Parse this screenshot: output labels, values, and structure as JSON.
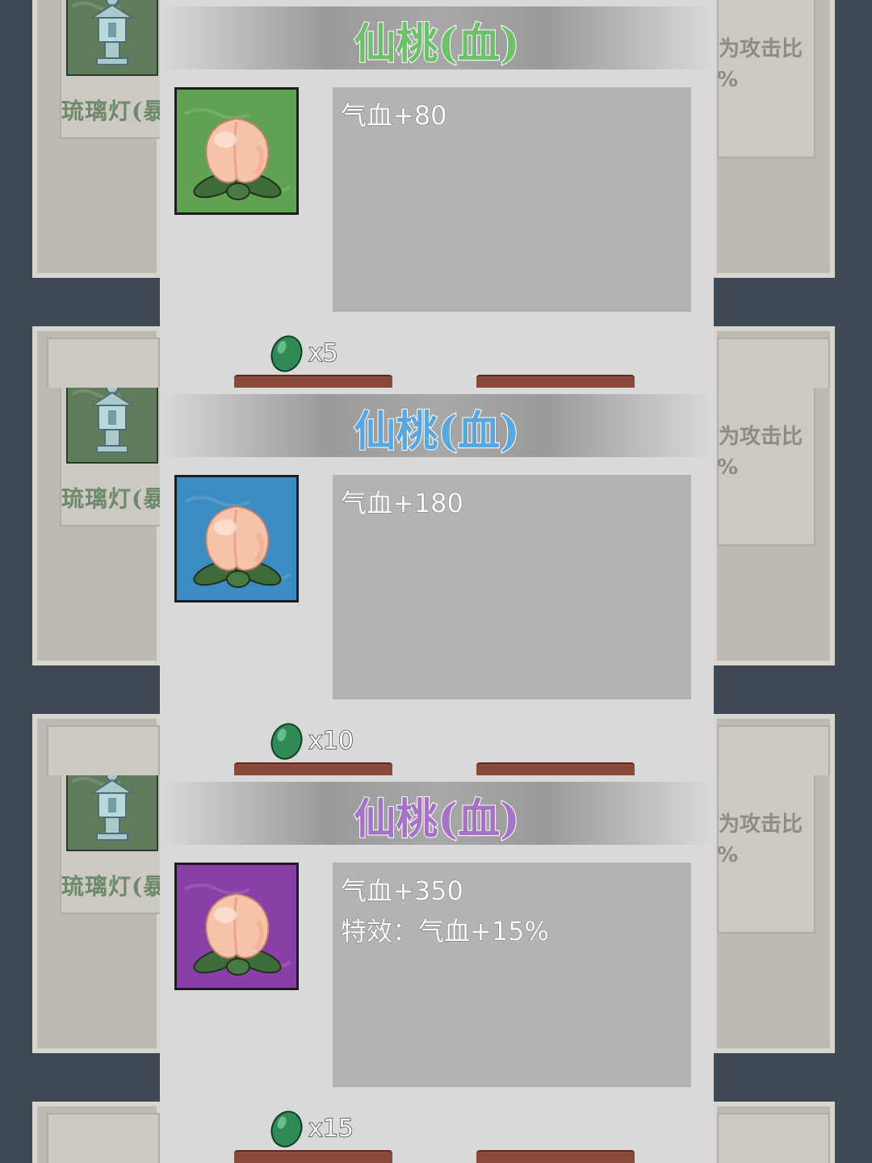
{
  "background": {
    "left_card_label": "琉璃灯(暴",
    "right_card_text": "为攻击比",
    "right_card_text2": "%"
  },
  "panels": [
    {
      "title": "仙桃(血)",
      "rarity_color": "#6fc06a",
      "icon_bg": "#5fa352",
      "icon_name": "peach-icon",
      "lines": [
        "气血+80"
      ],
      "cost_icon": "jade-gem-icon",
      "cost": "x5"
    },
    {
      "title": "仙桃(血)",
      "rarity_color": "#5aa6e0",
      "icon_bg": "#3c8cc4",
      "icon_name": "peach-icon",
      "lines": [
        "气血+180"
      ],
      "cost_icon": "jade-gem-icon",
      "cost": "x10"
    },
    {
      "title": "仙桃(血)",
      "rarity_color": "#a572c8",
      "icon_bg": "#8a3fa8",
      "icon_name": "peach-icon",
      "lines": [
        "气血+350",
        "特效：气血+15%"
      ],
      "cost_icon": "jade-gem-icon",
      "cost": "x15"
    }
  ]
}
